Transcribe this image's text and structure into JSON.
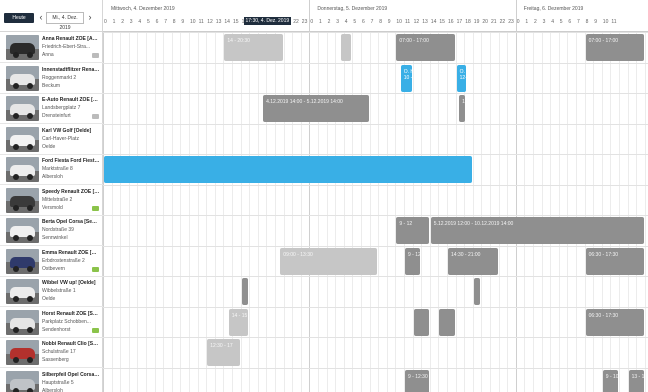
{
  "toolbar": {
    "today_label": "Heute",
    "prev_icon": "chevron-left-icon",
    "next_icon": "chevron-right-icon",
    "prev_glyph": "‹",
    "next_glyph": "›",
    "date_value": "Mi., 4. Dez. 2019"
  },
  "header": {
    "days": [
      {
        "label": "Mittwoch, 4. Dezember 2019"
      },
      {
        "label": "Donnerstag, 5. Dezember 2019"
      },
      {
        "label": "Freitag, 6. Dezember 2019"
      }
    ],
    "hours_day1": [
      "0",
      "1",
      "2",
      "3",
      "4",
      "5",
      "6",
      "7",
      "8",
      "9",
      "10",
      "11",
      "12",
      "13",
      "14",
      "15",
      "16",
      "17",
      "",
      "",
      "",
      "",
      "22",
      "23"
    ],
    "hours_day2": [
      "0",
      "1",
      "2",
      "3",
      "4",
      "5",
      "6",
      "7",
      "8",
      "9",
      "10",
      "11",
      "12",
      "13",
      "14",
      "15",
      "16",
      "17",
      "18",
      "19",
      "20",
      "21",
      "22",
      "23"
    ],
    "hours_day3": [
      "0",
      "1",
      "2",
      "3",
      "4",
      "5",
      "6",
      "7",
      "8",
      "9",
      "10",
      "11"
    ],
    "now_label": "17:30, 4. Dez. 2019"
  },
  "cars": [
    {
      "name": "Anna Renault ZOE [Anna]",
      "address": "Friedrich-Ebert-Stra...",
      "city": "Anna",
      "color": "#2b2b2b",
      "chip": "grey"
    },
    {
      "name": "Innenstadtflitzer Renault ...",
      "address": "Roggenmarkt 2",
      "city": "Beckum",
      "color": "#e8e8e8",
      "chip": "none"
    },
    {
      "name": "E-Auto Renault ZOE [Dren...",
      "address": "Landsbergplatz 7",
      "city": "Drensteinfurt",
      "color": "#e6e6e6",
      "chip": "grey"
    },
    {
      "name": "Karl VW Golf [Oelde]",
      "address": "Carl-Haver-Platz",
      "city": "Oelde",
      "color": "#f2f2f2",
      "chip": "none"
    },
    {
      "name": "Ford Fiesta Ford Fiesta [A...",
      "address": "Marktstraße 8",
      "city": "Albersloh",
      "color": "#ededed",
      "chip": "none"
    },
    {
      "name": "Speedy Renault ZOE [Vers...",
      "address": "Mittelstraße 2",
      "city": "Versmold",
      "color": "#3a3a3a",
      "chip": "green"
    },
    {
      "name": "Berta Opel Corsa [Sennwi...",
      "address": "Nordstraße 39",
      "city": "Sennwinkel",
      "color": "#f0f0f0",
      "chip": "none"
    },
    {
      "name": "Emma Renault ZOE [Ostb...",
      "address": "Erbdrostenstraße 2",
      "city": "Ostbevern",
      "color": "#2f3a6b",
      "chip": "green"
    },
    {
      "name": "Wibbel VW up! [Oelde]",
      "address": "Wibbelstraße 1",
      "city": "Oelde",
      "color": "#ececec",
      "chip": "none"
    },
    {
      "name": "Horst Renault ZOE [Sende...",
      "address": "Parkplatz Schobben...",
      "city": "Sendenhorst",
      "color": "#e5e5e5",
      "chip": "green"
    },
    {
      "name": "Nobbi Renault Clio [Sass...",
      "address": "Schulstraße 17",
      "city": "Sassenberg",
      "color": "#b3312d",
      "chip": "none"
    },
    {
      "name": "Silberpfeil Opel Corsa [Al...",
      "address": "Hauptstraße 5",
      "city": "Albersloh",
      "color": "#bfc3c7",
      "chip": "none"
    }
  ],
  "bookings": [
    {
      "row": 0,
      "start_h": 14.0,
      "end_h": 21.0,
      "style": "light",
      "text": "14 - 20:30"
    },
    {
      "row": 0,
      "start_h": 27.5,
      "end_h": 29.0,
      "style": "light",
      "text": ""
    },
    {
      "row": 0,
      "start_h": 34.0,
      "end_h": 41.0,
      "style": "dark",
      "text": "07:00 - 17:00"
    },
    {
      "row": 0,
      "start_h": 56.0,
      "end_h": 63.0,
      "style": "dark",
      "text": "07:00 - 17:00"
    },
    {
      "row": 1,
      "start_h": 34.5,
      "end_h": 36.0,
      "style": "blue",
      "text": "O. Hock\n10 - 12"
    },
    {
      "row": 1,
      "start_h": 41.0,
      "end_h": 42.3,
      "style": "blue",
      "text": "O. Hec\n12-30"
    },
    {
      "row": 2,
      "start_h": 18.5,
      "end_h": 31.0,
      "style": "dark",
      "text": "4.12.2019 14:00 - 5.12.2019 14:00"
    },
    {
      "row": 2,
      "start_h": 41.3,
      "end_h": 42.0,
      "style": "dark",
      "text": "16"
    },
    {
      "row": 4,
      "start_h": 0.0,
      "end_h": 43.0,
      "style": "blue",
      "text": ""
    },
    {
      "row": 6,
      "start_h": 34.0,
      "end_h": 38.0,
      "style": "dark",
      "text": "9 - 12"
    },
    {
      "row": 6,
      "start_h": 38.0,
      "end_h": 63.0,
      "style": "dark",
      "text": "5.12.2019 12:00 - 10.12.2019 14:00"
    },
    {
      "row": 7,
      "start_h": 20.5,
      "end_h": 32.0,
      "style": "light",
      "text": "09:00 - 13:30"
    },
    {
      "row": 7,
      "start_h": 35.0,
      "end_h": 37.0,
      "style": "dark",
      "text": "9 - 12"
    },
    {
      "row": 7,
      "start_h": 40.0,
      "end_h": 46.0,
      "style": "dark",
      "text": "14:30 - 21:00"
    },
    {
      "row": 7,
      "start_h": 56.0,
      "end_h": 63.0,
      "style": "dark",
      "text": "06:30 - 17:30"
    },
    {
      "row": 8,
      "start_h": 16.0,
      "end_h": 16.3,
      "style": "dark",
      "text": ""
    },
    {
      "row": 8,
      "start_h": 43.0,
      "end_h": 43.7,
      "style": "dark",
      "text": ""
    },
    {
      "row": 9,
      "start_h": 14.5,
      "end_h": 17.0,
      "style": "light",
      "text": "14 - 15"
    },
    {
      "row": 9,
      "start_h": 36.0,
      "end_h": 38.0,
      "style": "dark",
      "text": ""
    },
    {
      "row": 9,
      "start_h": 39.0,
      "end_h": 41.0,
      "style": "dark",
      "text": ""
    },
    {
      "row": 9,
      "start_h": 56.0,
      "end_h": 63.0,
      "style": "dark",
      "text": "06:30 - 17:30"
    },
    {
      "row": 10,
      "start_h": 12.0,
      "end_h": 16.0,
      "style": "light",
      "text": "12:30 - 17"
    },
    {
      "row": 11,
      "start_h": 35.0,
      "end_h": 38.0,
      "style": "dark",
      "text": "9 - 12:30"
    },
    {
      "row": 11,
      "start_h": 58.0,
      "end_h": 60.0,
      "style": "dark",
      "text": "9 - 10:30"
    },
    {
      "row": 11,
      "start_h": 61.0,
      "end_h": 63.0,
      "style": "dark",
      "text": "13 - 14"
    }
  ]
}
